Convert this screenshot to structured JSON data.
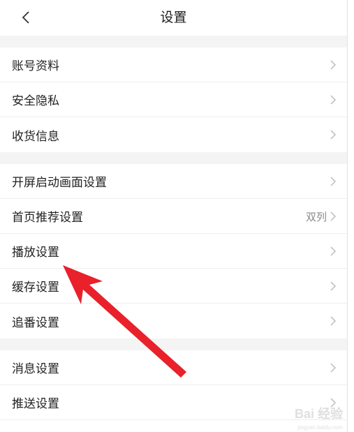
{
  "header": {
    "title": "设置",
    "back_icon": "chevron-left-icon"
  },
  "groups": [
    {
      "items": [
        {
          "label": "账号资料"
        },
        {
          "label": "安全隐私"
        },
        {
          "label": "收货信息"
        }
      ]
    },
    {
      "items": [
        {
          "label": "开屏启动画面设置"
        },
        {
          "label": "首页推荐设置",
          "value": "双列"
        },
        {
          "label": "播放设置"
        },
        {
          "label": "缓存设置"
        },
        {
          "label": "追番设置"
        }
      ]
    },
    {
      "items": [
        {
          "label": "消息设置"
        },
        {
          "label": "推送设置"
        }
      ]
    }
  ],
  "colors": {
    "annotation_arrow": "#e8212b",
    "divider": "#f4f4f4",
    "chevron": "#bdbdbd"
  },
  "watermark": {
    "main": "Bai 经验",
    "sub": "jingyan.baidu.com"
  }
}
